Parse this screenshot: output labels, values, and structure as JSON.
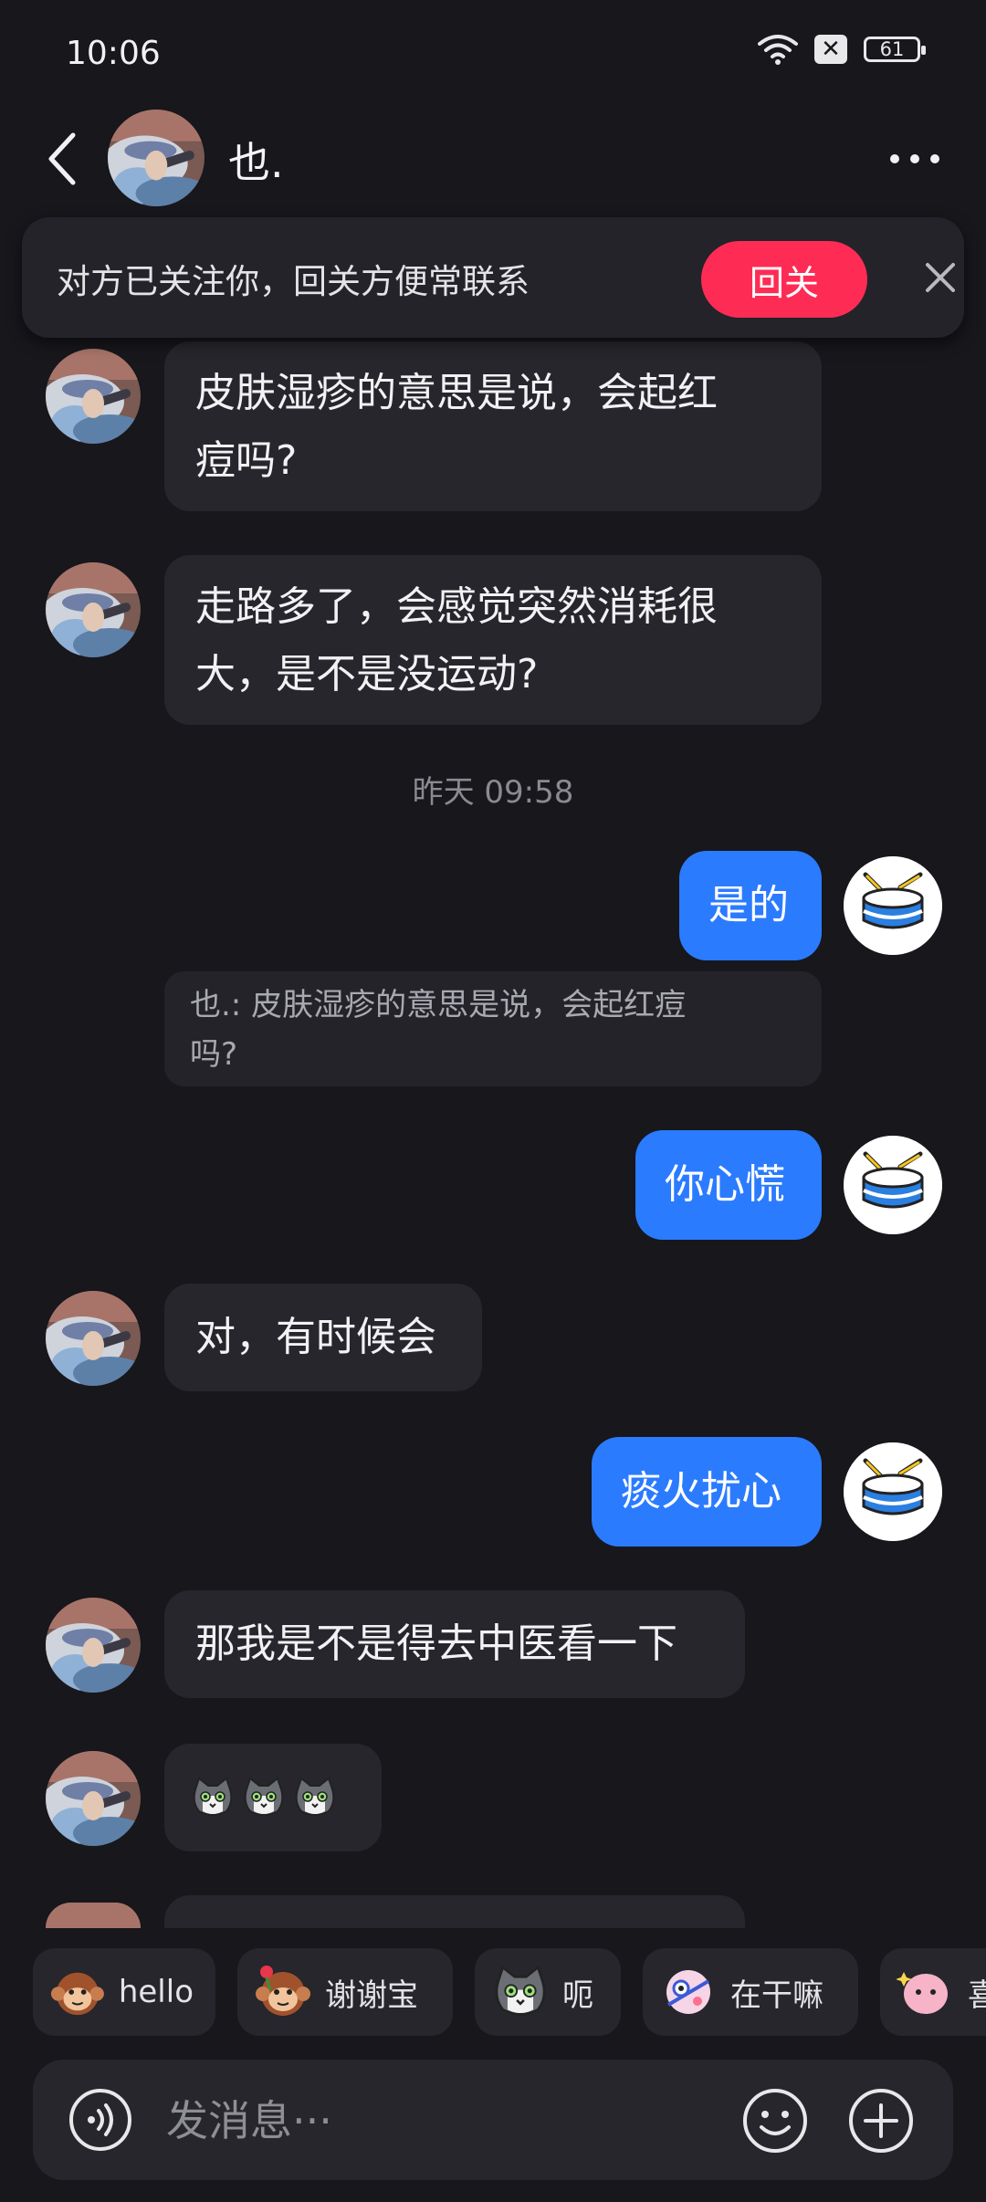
{
  "status_bar": {
    "time": "10:06",
    "battery": "61"
  },
  "header": {
    "contact_name": "也.",
    "back_icon": "chevron-left-icon",
    "more_icon": "more-dots-icon"
  },
  "follow_banner": {
    "text": "对方已关注你，回关方便常联系",
    "button_label": "回关"
  },
  "messages": [
    {
      "from": "them",
      "lines": [
        "皮肤湿疹的意思是说，会起红",
        "痘吗?"
      ]
    },
    {
      "from": "them",
      "lines": [
        "走路多了，会感觉突然消耗很",
        "大，是不是没运动?"
      ]
    },
    {
      "type": "timestamp",
      "text": "昨天 09:58"
    },
    {
      "from": "me",
      "text": "是的"
    },
    {
      "type": "quote",
      "lines": [
        "也.: 皮肤湿疹的意思是说，会起红痘",
        "吗?"
      ]
    },
    {
      "from": "me",
      "text": "你心慌"
    },
    {
      "from": "them",
      "text": "对，有时候会"
    },
    {
      "from": "me",
      "text": "痰火扰心"
    },
    {
      "from": "them",
      "text": "那我是不是得去中医看一下"
    },
    {
      "from": "them",
      "type": "stickers",
      "count": 3,
      "icon": "cat-face-icon"
    }
  ],
  "quick_replies": [
    {
      "label": "hello",
      "icon": "monkey-emoji-icon"
    },
    {
      "label": "谢谢宝",
      "icon": "monkey-rose-emoji-icon"
    },
    {
      "label": "呃",
      "icon": "cat-face-icon"
    },
    {
      "label": "在干嘛",
      "icon": "peeking-emoji-icon"
    },
    {
      "label": "喜",
      "icon": "sparkle-emoji-icon"
    }
  ],
  "input": {
    "placeholder": "发消息···"
  },
  "colors": {
    "background": "#17171c",
    "bubble_in": "#26262c",
    "bubble_out": "#2b7bff",
    "follow_button": "#fe2c55"
  }
}
